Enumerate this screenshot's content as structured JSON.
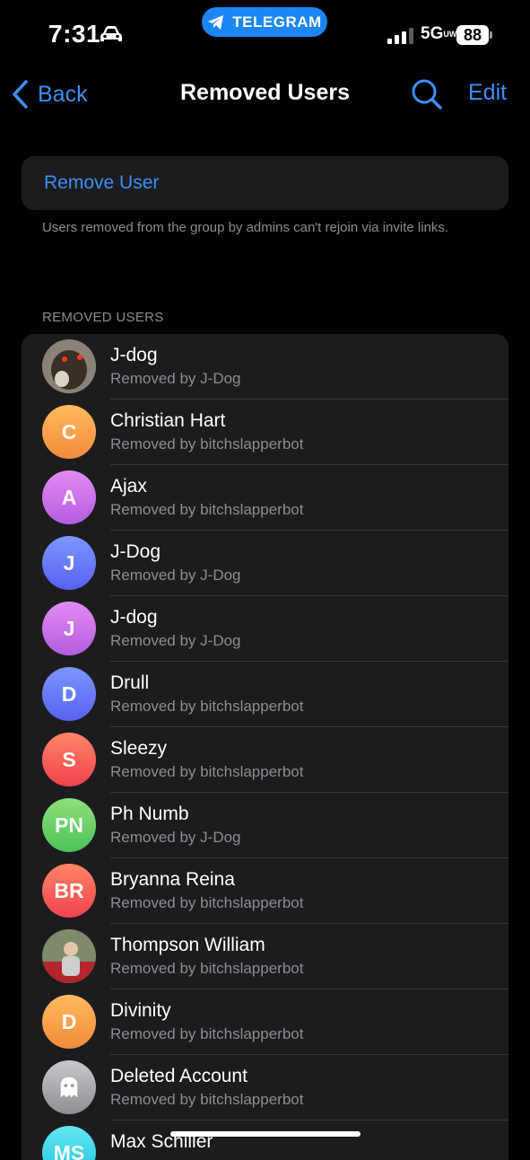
{
  "status": {
    "time": "7:31",
    "pill_label": "TELEGRAM",
    "network": "5G",
    "network_suffix": "UW",
    "battery": "88"
  },
  "nav": {
    "back_label": "Back",
    "title": "Removed Users",
    "edit_label": "Edit"
  },
  "remove_card": {
    "label": "Remove User"
  },
  "note": "Users removed from the group by admins can't rejoin via invite links.",
  "section_header": "REMOVED USERS",
  "colors": {
    "accent": "#3e8ef7",
    "background": "#000000",
    "cell": "#1c1c1e",
    "secondary_text": "#8d8d92"
  },
  "users": [
    {
      "name": "J-dog",
      "removed_by": "Removed by J-Dog",
      "initials": "",
      "avatar": "photo-dog"
    },
    {
      "name": "Christian Hart",
      "removed_by": "Removed by bitchslapperbot",
      "initials": "C",
      "avatar": "orange"
    },
    {
      "name": "Ajax",
      "removed_by": "Removed by bitchslapperbot",
      "initials": "A",
      "avatar": "purple"
    },
    {
      "name": "J-Dog",
      "removed_by": "Removed by J-Dog",
      "initials": "J",
      "avatar": "blue"
    },
    {
      "name": "J-dog",
      "removed_by": "Removed by J-Dog",
      "initials": "J",
      "avatar": "purple"
    },
    {
      "name": "Drull",
      "removed_by": "Removed by bitchslapperbot",
      "initials": "D",
      "avatar": "blue"
    },
    {
      "name": "Sleezy",
      "removed_by": "Removed by bitchslapperbot",
      "initials": "S",
      "avatar": "red"
    },
    {
      "name": "Ph Numb",
      "removed_by": "Removed by J-Dog",
      "initials": "PN",
      "avatar": "green"
    },
    {
      "name": "Bryanna Reina",
      "removed_by": "Removed by bitchslapperbot",
      "initials": "BR",
      "avatar": "red"
    },
    {
      "name": "Thompson William",
      "removed_by": "Removed by bitchslapperbot",
      "initials": "",
      "avatar": "photo-person"
    },
    {
      "name": "Divinity",
      "removed_by": "Removed by bitchslapperbot",
      "initials": "D",
      "avatar": "orange"
    },
    {
      "name": "Deleted Account",
      "removed_by": "Removed by bitchslapperbot",
      "initials": "",
      "avatar": "ghost"
    },
    {
      "name": "Max Schiller",
      "removed_by": "",
      "initials": "MS",
      "avatar": "cyan"
    }
  ]
}
